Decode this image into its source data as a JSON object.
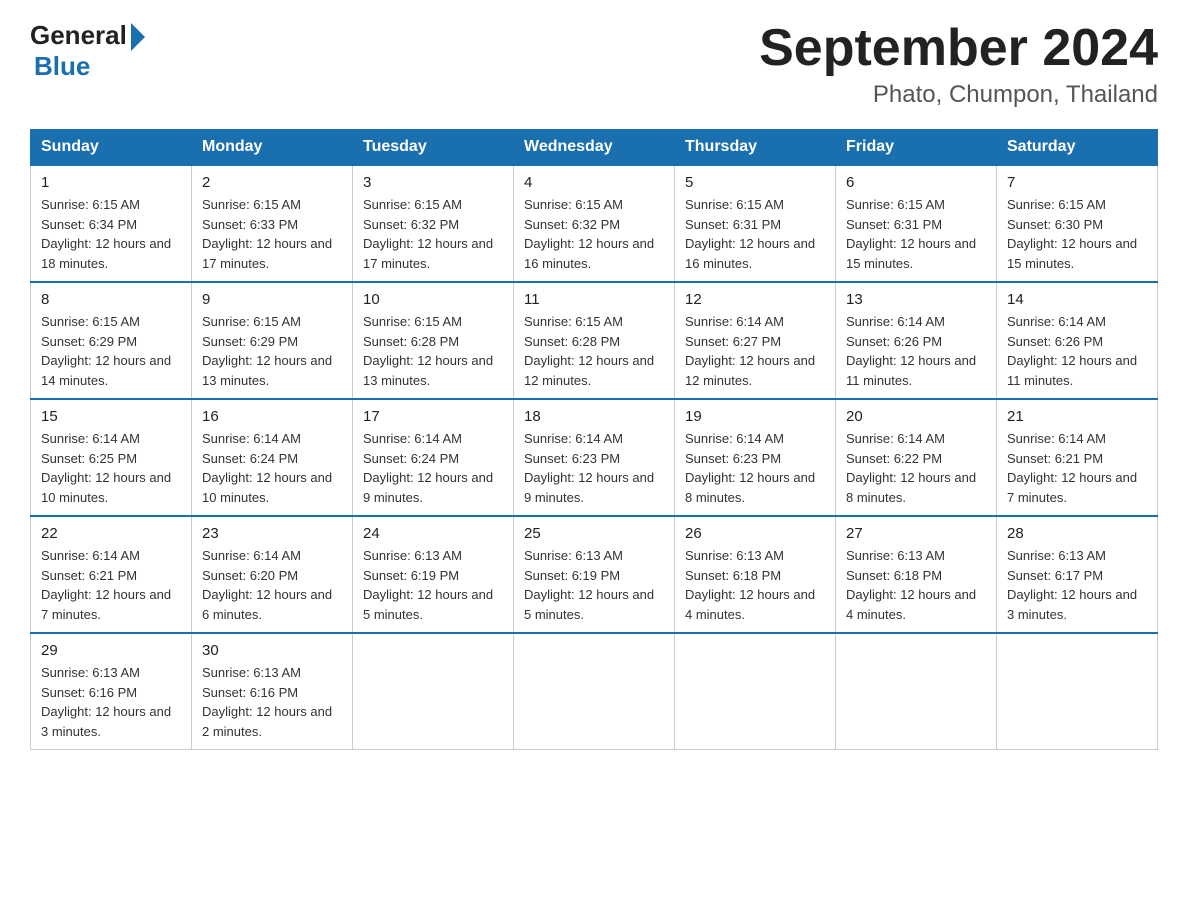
{
  "logo": {
    "general": "General",
    "blue": "Blue"
  },
  "title": "September 2024",
  "subtitle": "Phato, Chumpon, Thailand",
  "headers": [
    "Sunday",
    "Monday",
    "Tuesday",
    "Wednesday",
    "Thursday",
    "Friday",
    "Saturday"
  ],
  "weeks": [
    [
      {
        "day": "1",
        "sunrise": "6:15 AM",
        "sunset": "6:34 PM",
        "daylight": "12 hours and 18 minutes."
      },
      {
        "day": "2",
        "sunrise": "6:15 AM",
        "sunset": "6:33 PM",
        "daylight": "12 hours and 17 minutes."
      },
      {
        "day": "3",
        "sunrise": "6:15 AM",
        "sunset": "6:32 PM",
        "daylight": "12 hours and 17 minutes."
      },
      {
        "day": "4",
        "sunrise": "6:15 AM",
        "sunset": "6:32 PM",
        "daylight": "12 hours and 16 minutes."
      },
      {
        "day": "5",
        "sunrise": "6:15 AM",
        "sunset": "6:31 PM",
        "daylight": "12 hours and 16 minutes."
      },
      {
        "day": "6",
        "sunrise": "6:15 AM",
        "sunset": "6:31 PM",
        "daylight": "12 hours and 15 minutes."
      },
      {
        "day": "7",
        "sunrise": "6:15 AM",
        "sunset": "6:30 PM",
        "daylight": "12 hours and 15 minutes."
      }
    ],
    [
      {
        "day": "8",
        "sunrise": "6:15 AM",
        "sunset": "6:29 PM",
        "daylight": "12 hours and 14 minutes."
      },
      {
        "day": "9",
        "sunrise": "6:15 AM",
        "sunset": "6:29 PM",
        "daylight": "12 hours and 13 minutes."
      },
      {
        "day": "10",
        "sunrise": "6:15 AM",
        "sunset": "6:28 PM",
        "daylight": "12 hours and 13 minutes."
      },
      {
        "day": "11",
        "sunrise": "6:15 AM",
        "sunset": "6:28 PM",
        "daylight": "12 hours and 12 minutes."
      },
      {
        "day": "12",
        "sunrise": "6:14 AM",
        "sunset": "6:27 PM",
        "daylight": "12 hours and 12 minutes."
      },
      {
        "day": "13",
        "sunrise": "6:14 AM",
        "sunset": "6:26 PM",
        "daylight": "12 hours and 11 minutes."
      },
      {
        "day": "14",
        "sunrise": "6:14 AM",
        "sunset": "6:26 PM",
        "daylight": "12 hours and 11 minutes."
      }
    ],
    [
      {
        "day": "15",
        "sunrise": "6:14 AM",
        "sunset": "6:25 PM",
        "daylight": "12 hours and 10 minutes."
      },
      {
        "day": "16",
        "sunrise": "6:14 AM",
        "sunset": "6:24 PM",
        "daylight": "12 hours and 10 minutes."
      },
      {
        "day": "17",
        "sunrise": "6:14 AM",
        "sunset": "6:24 PM",
        "daylight": "12 hours and 9 minutes."
      },
      {
        "day": "18",
        "sunrise": "6:14 AM",
        "sunset": "6:23 PM",
        "daylight": "12 hours and 9 minutes."
      },
      {
        "day": "19",
        "sunrise": "6:14 AM",
        "sunset": "6:23 PM",
        "daylight": "12 hours and 8 minutes."
      },
      {
        "day": "20",
        "sunrise": "6:14 AM",
        "sunset": "6:22 PM",
        "daylight": "12 hours and 8 minutes."
      },
      {
        "day": "21",
        "sunrise": "6:14 AM",
        "sunset": "6:21 PM",
        "daylight": "12 hours and 7 minutes."
      }
    ],
    [
      {
        "day": "22",
        "sunrise": "6:14 AM",
        "sunset": "6:21 PM",
        "daylight": "12 hours and 7 minutes."
      },
      {
        "day": "23",
        "sunrise": "6:14 AM",
        "sunset": "6:20 PM",
        "daylight": "12 hours and 6 minutes."
      },
      {
        "day": "24",
        "sunrise": "6:13 AM",
        "sunset": "6:19 PM",
        "daylight": "12 hours and 5 minutes."
      },
      {
        "day": "25",
        "sunrise": "6:13 AM",
        "sunset": "6:19 PM",
        "daylight": "12 hours and 5 minutes."
      },
      {
        "day": "26",
        "sunrise": "6:13 AM",
        "sunset": "6:18 PM",
        "daylight": "12 hours and 4 minutes."
      },
      {
        "day": "27",
        "sunrise": "6:13 AM",
        "sunset": "6:18 PM",
        "daylight": "12 hours and 4 minutes."
      },
      {
        "day": "28",
        "sunrise": "6:13 AM",
        "sunset": "6:17 PM",
        "daylight": "12 hours and 3 minutes."
      }
    ],
    [
      {
        "day": "29",
        "sunrise": "6:13 AM",
        "sunset": "6:16 PM",
        "daylight": "12 hours and 3 minutes."
      },
      {
        "day": "30",
        "sunrise": "6:13 AM",
        "sunset": "6:16 PM",
        "daylight": "12 hours and 2 minutes."
      },
      null,
      null,
      null,
      null,
      null
    ]
  ]
}
